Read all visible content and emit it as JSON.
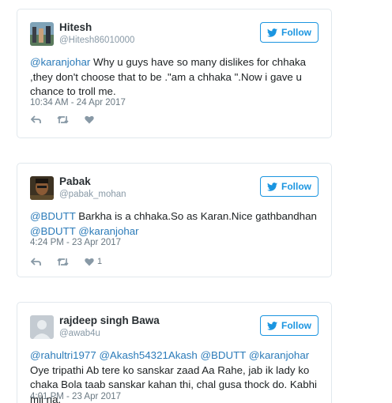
{
  "follow_label": "Follow",
  "colors": {
    "link": "#2b7bb9",
    "follow": "#1b95e0",
    "muted": "#8899a6",
    "border": "#e1e8ed"
  },
  "tweets": [
    {
      "name": "Hitesh",
      "handle": "@Hitesh86010000",
      "text_parts": [
        {
          "mention": "@karanjohar"
        },
        {
          "text": " Why u guys have so many dislikes for chhaka ,they don't choose that to be .\"am a chhaka \".Now i gave u chance to troll me."
        }
      ],
      "timestamp": "10:34 AM - 24 Apr 2017",
      "like_count": ""
    },
    {
      "name": "Pabak",
      "handle": "@pabak_mohan",
      "text_parts": [
        {
          "mention": "@BDUTT"
        },
        {
          "text": " Barkha is a chhaka.So as Karan.Nice gathbandhan "
        },
        {
          "mention": "@BDUTT"
        },
        {
          "text": " "
        },
        {
          "mention": "@karanjohar"
        }
      ],
      "timestamp": "4:24 PM - 23 Apr 2017",
      "like_count": "1"
    },
    {
      "name": "rajdeep singh Bawa",
      "handle": "@awab4u",
      "text_parts": [
        {
          "mention": "@rahultri1977"
        },
        {
          "text": " "
        },
        {
          "mention": "@Akash54321Akash"
        },
        {
          "text": " "
        },
        {
          "mention": "@BDUTT"
        },
        {
          "text": " "
        },
        {
          "mention": "@karanjohar"
        },
        {
          "text": " Oye tripathi Ab tere ko sanskar zaad Aa Rahe, jab ik lady ko chaka Bola taab sanskar kahan thi, chal gusa thock do. Kabhi mil na."
        }
      ],
      "timestamp": "4:01 PM - 23 Apr 2017",
      "like_count": ""
    }
  ]
}
